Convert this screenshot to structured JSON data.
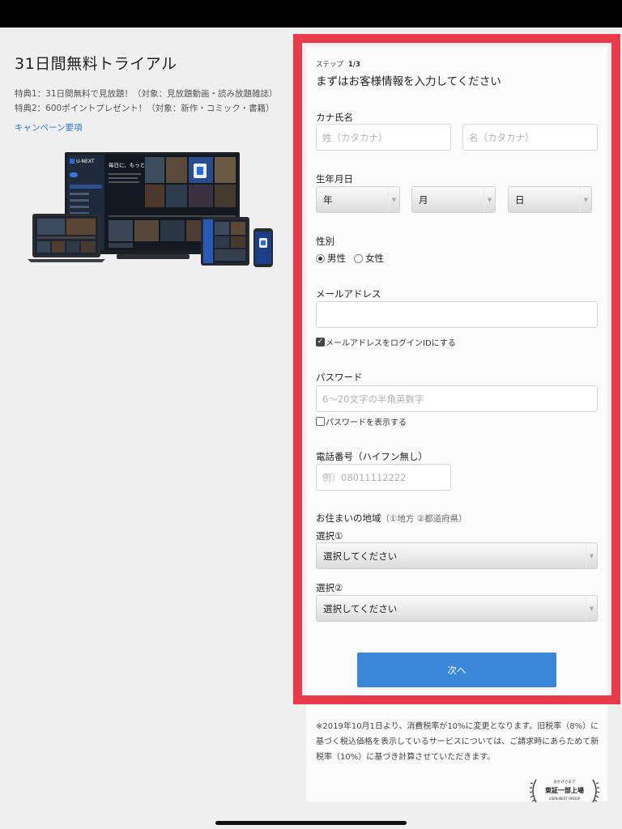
{
  "promo": {
    "title": "31日間無料トライアル",
    "perk1": "特典1：31日間無料で見放題！（対象：見放題動画・読み放題雑誌）",
    "perk2": "特典2：600ポイントプレゼント！（対象：新作・コミック・書籍）",
    "campaign_link": "キャンペーン要項"
  },
  "devices_image": {
    "brand": "U-NEXT",
    "tagline": "毎日に、もっと物語を。"
  },
  "form": {
    "step_prefix": "ステップ",
    "step_value": "1/3",
    "heading": "まずはお客様情報を入力してください",
    "kana_name": {
      "label": "カナ氏名",
      "last_placeholder": "姓（カタカナ）",
      "first_placeholder": "名（カタカナ）"
    },
    "birthdate": {
      "label": "生年月日",
      "year": "年",
      "month": "月",
      "day": "日"
    },
    "gender": {
      "label": "性別",
      "male": "男性",
      "female": "女性",
      "selected": "male"
    },
    "email": {
      "label": "メールアドレス",
      "value": "",
      "use_as_login_label": "メールアドレスをログインIDにする",
      "use_as_login_checked": true
    },
    "password": {
      "label": "パスワード",
      "placeholder": "6〜20文字の半角英数字",
      "show_label": "パスワードを表示する",
      "show_checked": false
    },
    "phone": {
      "label": "電話番号（ハイフン無し）",
      "placeholder": "例）08011112222"
    },
    "region": {
      "label": "お住まいの地域",
      "hint": "（①地方 ②都道府県）",
      "select1_label": "選択①",
      "select1_value": "選択してください",
      "select2_label": "選択②",
      "select2_value": "選択してください"
    },
    "next_button": "次へ"
  },
  "tax_note": "※2019年10月1日より、消費税率が10%に変更となります。旧税率（8%）に基づく税込価格を表示しているサービスについては、ご請求時にあらためて新税率（10%）に基づき計算させていただきます。",
  "badge": {
    "line1": "おかげさまで",
    "line2": "東証一部上場",
    "line3": "USEN-NEXT GROUP"
  },
  "colors": {
    "highlight_frame": "#e83a4a",
    "primary_button": "#3a86d9",
    "link": "#2a78c8"
  }
}
